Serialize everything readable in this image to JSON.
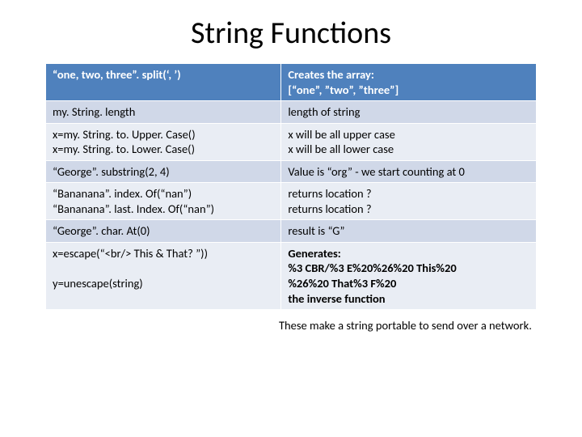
{
  "title": "String Functions",
  "rows": [
    {
      "left": "“one, two, three”. split(‘, ’)",
      "right": "Creates the array:\n[“one”, ”two”, ”three”]"
    },
    {
      "left": "my. String. length",
      "right": "length of string"
    },
    {
      "left": "x=my. String. to. Upper. Case()\nx=my. String. to. Lower. Case()",
      "right": "x will be all upper case\nx will be all lower case"
    },
    {
      "left": "“George”. substring(2, 4)",
      "right": "Value is “org”  - we start counting at 0"
    },
    {
      "left": "“Bananana”. index. Of(“nan”)\n“Bananana”. last. Index. Of(“nan”)",
      "right": "returns location ?\nreturns location ?"
    },
    {
      "left": "“George”. char. At(0)",
      "right": "result is “G”"
    },
    {
      "left": "x=escape(“<br/> This & That? ”))\n\ny=unescape(string)",
      "right": "Generates:\n%3 CBR/%3 E%20%26%20 This%20\n%26%20 That%3 F%20\n the inverse function"
    }
  ],
  "footnote": "These make a string portable to send over a network."
}
